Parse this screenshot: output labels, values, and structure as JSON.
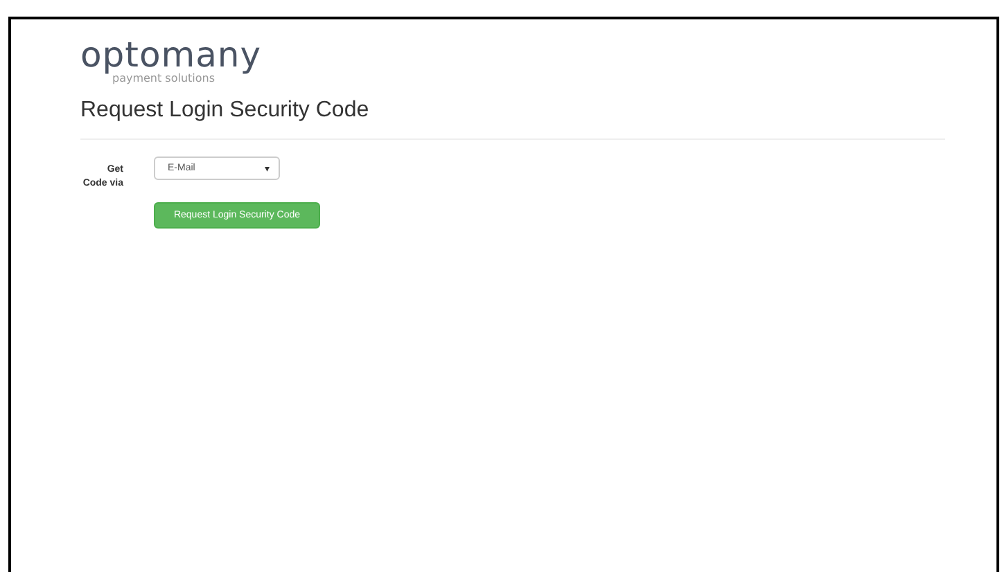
{
  "logo": {
    "name": "optomany",
    "tagline": "payment solutions"
  },
  "heading": "Request Login Security Code",
  "form": {
    "label": "Get Code via",
    "select": {
      "value": "E-Mail",
      "caret": "▾"
    },
    "button": "Request Login Security Code"
  }
}
